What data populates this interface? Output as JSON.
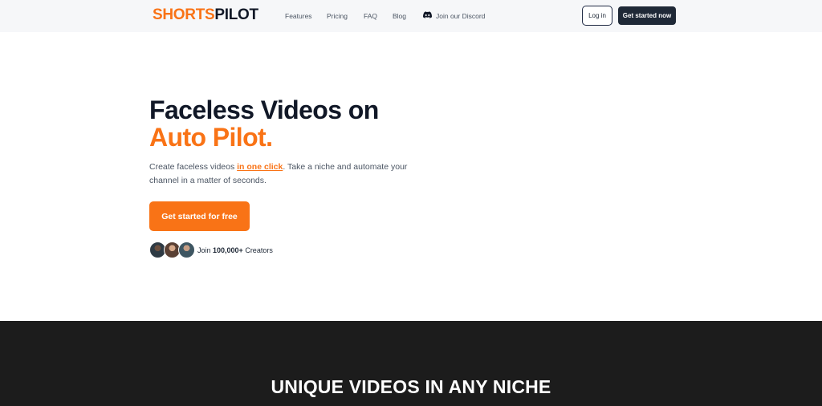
{
  "header": {
    "logo_part1": "SHORTS",
    "logo_part2": "PILOT",
    "nav": {
      "features": "Features",
      "pricing": "Pricing",
      "faq": "FAQ",
      "blog": "Blog",
      "discord": "Join our Discord"
    },
    "login_label": "Log in",
    "start_label": "Get started now"
  },
  "hero": {
    "title_line1": "Faceless Videos on",
    "title_line2": "Auto Pilot.",
    "desc_before": "Create faceless videos ",
    "desc_highlight": "in one click",
    "desc_after": ". Take a niche and automate your channel in a matter of seconds.",
    "cta_label": "Get started for free",
    "join_prefix": "Join ",
    "join_count": "100,000+",
    "join_suffix": " Creators"
  },
  "section": {
    "title": "UNIQUE VIDEOS IN ANY NICHE"
  },
  "colors": {
    "accent": "#f97316",
    "dark": "#1f2937",
    "section_bg": "#1c1c1c"
  }
}
